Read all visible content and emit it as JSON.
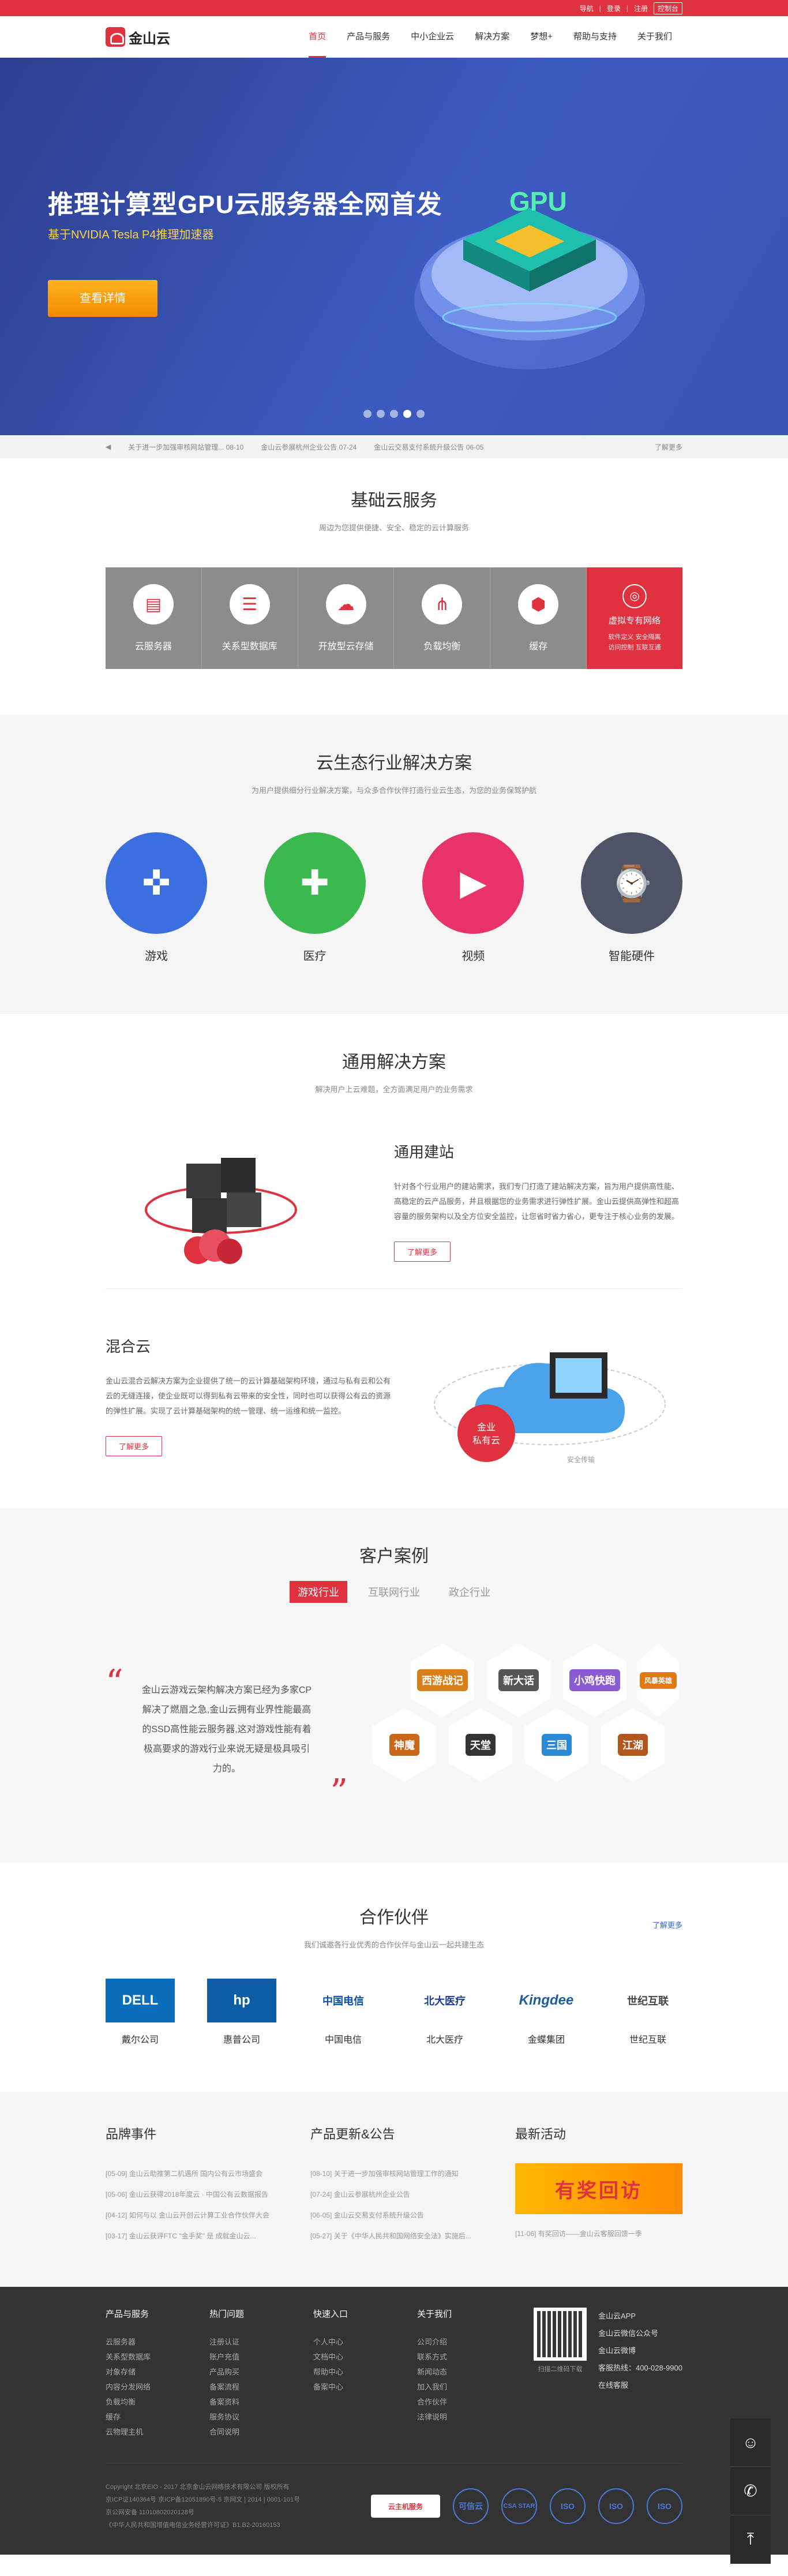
{
  "topbar": {
    "links": [
      "导航",
      "登录",
      "注册"
    ],
    "console": "控制台"
  },
  "brand": {
    "logo_text": "金山云",
    "accent": "#e0313e"
  },
  "nav": [
    "首页",
    "产品与服务",
    "中小企业云",
    "解决方案",
    "梦想+",
    "帮助与支持",
    "关于我们"
  ],
  "banner": {
    "title": "推理计算型GPU云服务器全网首发",
    "subtitle": "基于NVIDIA Tesla P4推理加速器",
    "cta": "查看详情",
    "art_label": "GPU"
  },
  "notice": {
    "items": [
      {
        "text": "关于进一步加强审核网站管理...",
        "date": "08-10"
      },
      {
        "text": "金山云参展杭州企业公告",
        "date": "07-24"
      },
      {
        "text": "金山云交易支付系统升级公告",
        "date": "06-05"
      }
    ],
    "more": "了解更多"
  },
  "basic": {
    "title": "基础云服务",
    "subtitle": "周边为您提供便捷、安全、稳定的云计算服务",
    "items": [
      "云服务器",
      "关系型数据库",
      "开放型云存储",
      "负载均衡",
      "缓存"
    ],
    "featured": {
      "title": "虚拟专有网络",
      "desc": "软件定义 安全隔离\n访问控制 互联互通"
    }
  },
  "eco": {
    "title": "云生态行业解决方案",
    "subtitle": "为用户提供细分行业解决方案，与众多合作伙伴打造行业云生态，为您的业务保驾护航",
    "items": [
      "游戏",
      "医疗",
      "视频",
      "智能硬件"
    ]
  },
  "general": {
    "title": "通用解决方案",
    "subtitle": "解决用户上云难题，全方面满足用户的业务需求",
    "site": {
      "title": "通用建站",
      "desc": "针对各个行业用户的建站需求，我们专门打造了建站解决方案，旨为用户提供高性能、高稳定的云产品服务，并且根据您的业务需求进行弹性扩展。金山云提供高弹性和超高容量的服务架构以及全方位安全监控，让您省时省力省心，更专注于核心业务的发展。",
      "btn": "了解更多"
    },
    "hybrid": {
      "title": "混合云",
      "desc": "金山云混合云解决方案为企业提供了统一的云计算基础架构环境，通过与私有云和公有云的无缝连接，使企业既可以得到私有云带来的安全性，同时也可以获得公有云的资源的弹性扩展。实现了云计算基础架构的统一管理、统一运维和统一监控。",
      "btn": "了解更多",
      "art_label": "金业\n私有云",
      "art_tag": "安全传输"
    }
  },
  "cases": {
    "title": "客户案例",
    "tabs": [
      "游戏行业",
      "互联网行业",
      "政企行业"
    ],
    "quote": "金山云游戏云架构解决方案已经为多家CP解决了燃眉之急,金山云拥有业界性能最高的SSD高性能云服务器,这对游戏性能有着极高要求的游戏行业来说无疑是极具吸引力的。",
    "logos": [
      "西游战记",
      "新大话",
      "小鸡快跑",
      "风暴英雄",
      "神魔",
      "天堂",
      "三国",
      "江湖"
    ]
  },
  "partners": {
    "title": "合作伙伴",
    "subtitle": "我们诚邀各行业优秀的合作伙伴与金山云一起共建生态",
    "more": "了解更多",
    "items": [
      {
        "name": "戴尔公司",
        "logo": "DELL",
        "color": "#0a6ebd"
      },
      {
        "name": "惠普公司",
        "logo": "hp",
        "color": "#0d5ea6"
      },
      {
        "name": "中国电信",
        "logo": "中国电信",
        "color": "#0d4fa8"
      },
      {
        "name": "北大医疗",
        "logo": "北大医疗",
        "color": "#1f3f8c"
      },
      {
        "name": "金蝶集团",
        "logo": "Kingdee",
        "color": "#1d5c9e"
      },
      {
        "name": "世纪互联",
        "logo": "世纪互联",
        "color": "#444"
      }
    ]
  },
  "news": {
    "cols": [
      {
        "title": "品牌事件",
        "items": [
          "[05-09] 金山云助推第二机遇所 国内公有云市场盛会",
          "[05-06] 金山云获得2018年度云 · 中国公有云数据报告",
          "[04-12] 如何与以 金山云开创云计算工业合作伙伴大会",
          "[03-17] 金山云获评FTC \"金手奖\" 是 成就金山云..."
        ]
      },
      {
        "title": "产品更新&公告",
        "items": [
          "[08-10] 关于进一步加强审核网站管理工作的通知",
          "[07-24] 金山云参展杭州企业公告",
          "[06-05] 金山云交易支付系统升级公告",
          "[05-27] 关于《中华人民共和国网络安全法》实施后..."
        ]
      },
      {
        "title": "最新活动",
        "items": [
          "[11-06] 有奖回访——金山云客服回馈一季"
        ],
        "promo": "有奖回访"
      }
    ]
  },
  "footer": {
    "cols": [
      {
        "title": "产品与服务",
        "items": [
          "云服务器",
          "关系型数据库",
          "对象存储",
          "内容分发网络",
          "负载均衡",
          "缓存",
          "云物理主机"
        ]
      },
      {
        "title": "热门问题",
        "items": [
          "注册认证",
          "账户充值",
          "产品购买",
          "备案流程",
          "备案资料",
          "服务协议",
          "合同说明"
        ]
      },
      {
        "title": "快速入口",
        "items": [
          "个人中心",
          "文档中心",
          "帮助中心",
          "备案中心"
        ]
      },
      {
        "title": "关于我们",
        "items": [
          "公司介绍",
          "联系方式",
          "新闻动态",
          "加入我们",
          "合作伙伴",
          "法律说明"
        ]
      }
    ],
    "app": {
      "name": "金山云APP",
      "wechat": "金山云微信公众号",
      "weibo": "金山云微博",
      "hotline": "客服热线：400-028-9900",
      "online": "在线客服",
      "qr_caption": "扫描二维码下载"
    },
    "copyright": [
      "Copyright 北京EIO - 2017 北京金山云网络技术有限公司 版权所有",
      "京ICP证140364号 京ICP备12051890号-5 京网文 | 2014 | 0001-101号",
      "京公网安备 11010802020128号",
      "《中华人民共和国增值电信业务经营许可证》B1.B2-20160153"
    ],
    "badges": [
      "云主机服务",
      "可信云",
      "CSA STAR",
      "ISO",
      "ISO",
      "ISO"
    ]
  },
  "side": [
    "客服",
    "电话",
    "顶部"
  ]
}
